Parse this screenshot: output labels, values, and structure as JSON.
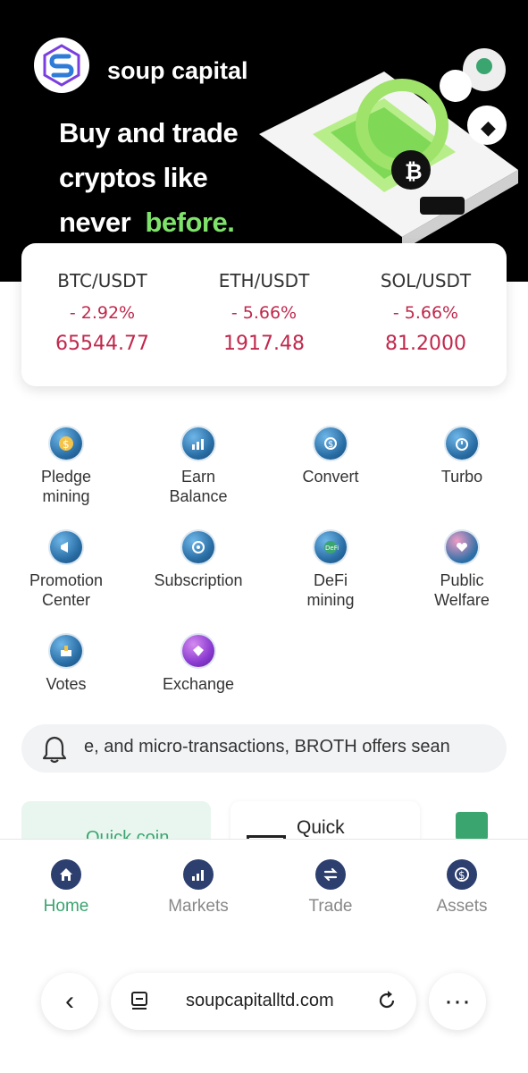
{
  "banner": {
    "brand": "soup capital",
    "headline_line1": "Buy and trade",
    "headline_line2": "cryptos like",
    "headline_line3_a": "never",
    "headline_line3_b": "before.",
    "accent_color": "#7ee36a"
  },
  "ticker": [
    {
      "pair": "BTC/USDT",
      "change": "- 2.92%",
      "price": "65544.77"
    },
    {
      "pair": "ETH/USDT",
      "change": "- 5.66%",
      "price": "1917.48"
    },
    {
      "pair": "SOL/USDT",
      "change": "- 5.66%",
      "price": "81.2000"
    }
  ],
  "features": [
    {
      "label": "Pledge mining",
      "icon": "dollar-coin-icon"
    },
    {
      "label": "Earn Balance",
      "icon": "growth-chart-icon"
    },
    {
      "label": "Convert",
      "icon": "convert-icon"
    },
    {
      "label": "Turbo",
      "icon": "stopwatch-icon"
    },
    {
      "label": "Promotion Center",
      "icon": "megaphone-icon"
    },
    {
      "label": "Subscription",
      "icon": "subscription-icon"
    },
    {
      "label": "DeFi mining",
      "icon": "defi-icon"
    },
    {
      "label": "Public Welfare",
      "icon": "heart-hand-icon"
    },
    {
      "label": "Votes",
      "icon": "ballot-box-icon"
    },
    {
      "label": "Exchange",
      "icon": "diamond-icon"
    }
  ],
  "notice": {
    "text": "e, and micro-transactions, BROTH offers sean"
  },
  "quick": {
    "card1": "Quick coin",
    "card2": "Quick"
  },
  "tabs": [
    {
      "label": "Home",
      "icon": "home-icon",
      "active": true
    },
    {
      "label": "Markets",
      "icon": "chart-icon",
      "active": false
    },
    {
      "label": "Trade",
      "icon": "swap-icon",
      "active": false
    },
    {
      "label": "Assets",
      "icon": "dollar-icon",
      "active": false
    }
  ],
  "browser": {
    "url": "soupcapitalltd.com",
    "back": "‹",
    "more": "···"
  },
  "colors": {
    "negative": "#c0284c",
    "active_tab": "#3aa56f",
    "icon_blue": "#2a6fa6"
  }
}
